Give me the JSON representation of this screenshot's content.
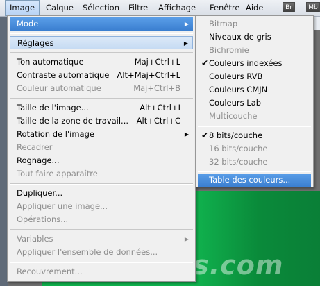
{
  "menubar": {
    "items": [
      "Image",
      "Calque",
      "Sélection",
      "Filtre",
      "Affichage",
      "Fenêtre",
      "Aide"
    ],
    "active_index": 0,
    "badges": [
      "Br",
      "Mb"
    ]
  },
  "image_menu": {
    "mode": "Mode",
    "reglages": "Réglages",
    "ton_auto": "Ton automatique",
    "ton_auto_sc": "Maj+Ctrl+L",
    "contraste_auto": "Contraste automatique",
    "contraste_auto_sc": "Alt+Maj+Ctrl+L",
    "couleur_auto": "Couleur automatique",
    "couleur_auto_sc": "Maj+Ctrl+B",
    "taille_image": "Taille de l'image...",
    "taille_image_sc": "Alt+Ctrl+I",
    "taille_zone": "Taille de la zone de travail...",
    "taille_zone_sc": "Alt+Ctrl+C",
    "rotation": "Rotation de l'image",
    "recadrer": "Recadrer",
    "rognage": "Rognage...",
    "tout_afficher": "Tout faire apparaître",
    "dupliquer": "Dupliquer...",
    "appliquer_image": "Appliquer une image...",
    "operations": "Opérations...",
    "variables": "Variables",
    "appliquer_donnees": "Appliquer l'ensemble de données...",
    "recouvrement": "Recouvrement..."
  },
  "mode_menu": {
    "bitmap": "Bitmap",
    "niveaux_gris": "Niveaux de gris",
    "bichromie": "Bichromie",
    "couleurs_indexees": "Couleurs indexées",
    "couleurs_rvb": "Couleurs RVB",
    "couleurs_cmjn": "Couleurs CMJN",
    "couleurs_lab": "Couleurs Lab",
    "multicouche": "Multicouche",
    "bits8": "8 bits/couche",
    "bits16": "16 bits/couche",
    "bits32": "32 bits/couche",
    "table_couleurs": "Table des couleurs..."
  },
  "watermark": "MyDrivers.com",
  "colors": {
    "highlight": "#3b7fd0",
    "canvas": "#10b24e"
  }
}
